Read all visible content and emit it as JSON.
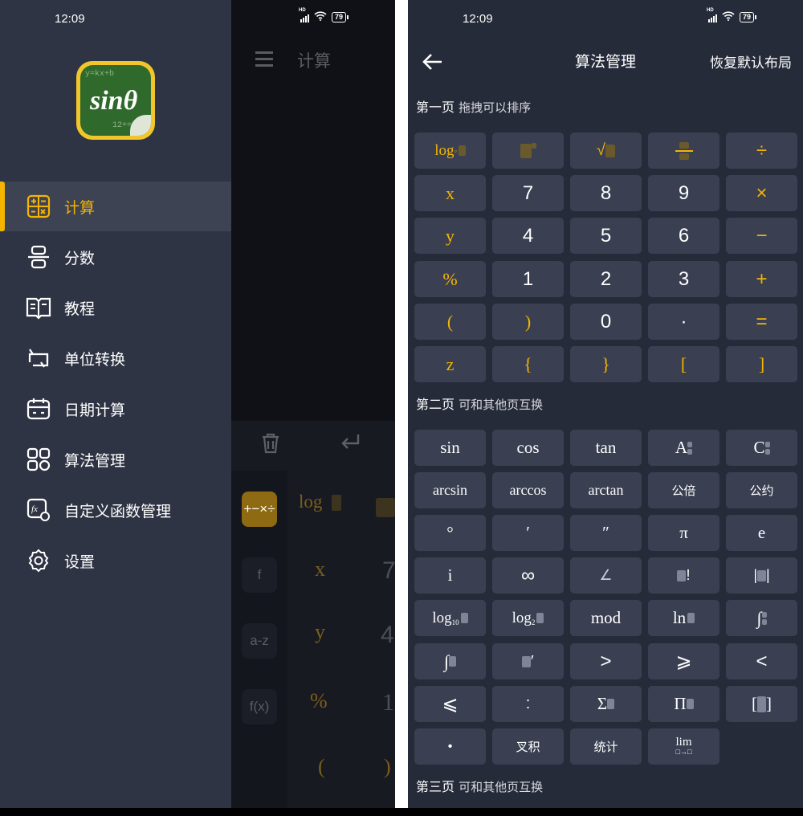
{
  "status": {
    "time": "12:09",
    "battery": "79",
    "network": "HD"
  },
  "drawer": {
    "logo": "sinθ",
    "items": [
      {
        "label": "计算",
        "icon": "calculator-icon",
        "active": true
      },
      {
        "label": "分数",
        "icon": "fraction-icon"
      },
      {
        "label": "教程",
        "icon": "book-icon"
      },
      {
        "label": "单位转换",
        "icon": "convert-icon"
      },
      {
        "label": "日期计算",
        "icon": "calendar-icon"
      },
      {
        "label": "算法管理",
        "icon": "grid-settings-icon"
      },
      {
        "label": "自定义函数管理",
        "icon": "custom-function-icon"
      },
      {
        "label": "设置",
        "icon": "gear-icon"
      }
    ]
  },
  "main_behind": {
    "title": "计算",
    "modes": [
      "+−×÷",
      "f",
      "a-z",
      "f(x)"
    ],
    "col1": [
      "log",
      "x",
      "y",
      "%",
      "("
    ],
    "col2": [
      "7",
      "4",
      "1",
      ")"
    ]
  },
  "algo": {
    "title": "算法管理",
    "reset": "恢复默认布局",
    "page1": {
      "title": "第一页",
      "sub": "拖拽可以排序"
    },
    "page2": {
      "title": "第二页",
      "sub": "可和其他页互换"
    },
    "page3": {
      "title": "第三页",
      "sub": "可和其他页互换"
    },
    "page2_keys": {
      "sin": "sin",
      "cos": "cos",
      "tan": "tan",
      "arcsin": "arcsin",
      "arccos": "arccos",
      "arctan": "arctan",
      "lcm": "公倍",
      "gcd": "公约",
      "degree": "°",
      "minute": "′",
      "second": "″",
      "pi": "π",
      "e": "e",
      "i": "i",
      "infinity": "∞",
      "angle": "∠",
      "gt": ">",
      "ge": "⩾",
      "lt": "<",
      "le": "⩽",
      "colon": ":",
      "dot": "•",
      "cross": "叉积",
      "stats": "统计",
      "mod": "mod",
      "ln": "ln",
      "lim": "lim",
      "log10": "log",
      "log2": "log",
      "sum": "Σ",
      "prod": "Π",
      "A": "A",
      "C": "C"
    },
    "page1_keys": {
      "log": "log",
      "div": "÷",
      "x": "x",
      "y": "y",
      "z": "z",
      "mul": "×",
      "minus": "−",
      "plus": "+",
      "eq": "=",
      "pct": "%",
      "lp": "(",
      "rp": ")",
      "lb": "{",
      "rb": "}",
      "lsb": "[",
      "rsb": "]",
      "dot": "·",
      "n7": "7",
      "n8": "8",
      "n9": "9",
      "n4": "4",
      "n5": "5",
      "n6": "6",
      "n1": "1",
      "n2": "2",
      "n3": "3",
      "n0": "0"
    }
  }
}
